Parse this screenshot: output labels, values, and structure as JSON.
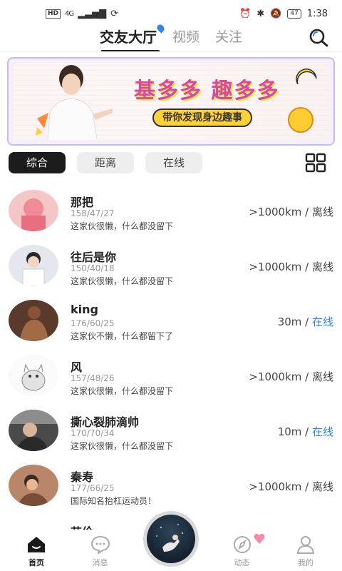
{
  "status_bar": {
    "hd": "HD",
    "network": "4G",
    "battery": "47",
    "time": "1:38"
  },
  "nav": {
    "tabs": [
      {
        "label": "交友大厅",
        "active": true
      },
      {
        "label": "视频",
        "active": false
      },
      {
        "label": "关注",
        "active": false
      }
    ]
  },
  "banner": {
    "title": "基多多 趣多多",
    "subtitle": "带你发现身边趣事"
  },
  "filters": {
    "chips": [
      {
        "label": "综合",
        "active": true
      },
      {
        "label": "距离",
        "active": false
      },
      {
        "label": "在线",
        "active": false
      }
    ]
  },
  "users": [
    {
      "name": "那把",
      "stats": "158/47/27",
      "signature": "这家伙很懒，什么都没留下",
      "distance": ">1000km",
      "status": "离线",
      "online": false,
      "avatar_color": "#f2a0a8"
    },
    {
      "name": "往后是你",
      "stats": "150/40/18",
      "signature": "这家伙很懒，什么都没留下",
      "distance": ">1000km",
      "status": "离线",
      "online": false,
      "avatar_color": "#d9dde4"
    },
    {
      "name": "king",
      "stats": "176/60/25",
      "signature": "这家伙不懒，什么都留下了",
      "distance": "30m",
      "status": "在线",
      "online": true,
      "avatar_color": "#8c5a3c"
    },
    {
      "name": "风",
      "stats": "157/48/26",
      "signature": "这家伙很懒，什么都没留下",
      "distance": ">1000km",
      "status": "离线",
      "online": false,
      "avatar_color": "#f2f2f2"
    },
    {
      "name": "撕心裂肺滴帅",
      "stats": "170/70/34",
      "signature": "这家伙很懒，什么都没留下",
      "distance": "10m",
      "status": "在线",
      "online": true,
      "avatar_color": "#5a5a5a"
    },
    {
      "name": "秦寿",
      "stats": "177/66/25",
      "signature": "国际知名抬杠运动员！",
      "distance": ">1000km",
      "status": "离线",
      "online": false,
      "avatar_color": "#c58a62"
    },
    {
      "name": "艾伦",
      "stats": "",
      "signature": "",
      "distance": "",
      "status": "",
      "online": false,
      "avatar_color": "#1a1a1a"
    }
  ],
  "bottom_nav": {
    "items": [
      {
        "label": "首页",
        "active": true
      },
      {
        "label": "消息",
        "active": false
      },
      {
        "label": "动态",
        "active": false
      },
      {
        "label": "我的",
        "active": false
      }
    ]
  },
  "colors": {
    "online": "#2f86e8",
    "accent_pink": "#d44aa4",
    "accent_yellow": "#ffd23a",
    "chip_active": "#1c1c1c"
  },
  "icons": [
    "search-icon",
    "grid-view-icon",
    "home-icon",
    "message-icon",
    "moments-icon",
    "profile-icon",
    "heart-icon"
  ]
}
